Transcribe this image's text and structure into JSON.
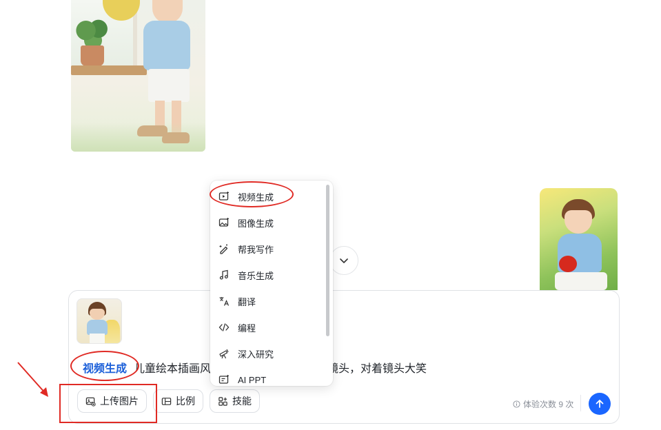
{
  "chat": {
    "top_image_alt": "",
    "right_image_alt": ""
  },
  "composer": {
    "mode_tag": "视频生成",
    "prompt_text": "儿童绘本插画风",
    "prompt_tail": "，展示给镜头，对着镜头大笑",
    "upload_label": "上传图片",
    "ratio_label": "比例",
    "skills_label": "技能",
    "quota_text": "体验次数 9 次"
  },
  "skills_menu": {
    "items": [
      {
        "label": "视频生成",
        "icon": "video-generate-icon"
      },
      {
        "label": "图像生成",
        "icon": "image-generate-icon"
      },
      {
        "label": "帮我写作",
        "icon": "pen-write-icon"
      },
      {
        "label": "音乐生成",
        "icon": "music-note-icon"
      },
      {
        "label": "翻译",
        "icon": "translate-icon"
      },
      {
        "label": "编程",
        "icon": "code-icon"
      },
      {
        "label": "深入研究",
        "icon": "telescope-icon"
      },
      {
        "label": "AI PPT",
        "icon": "ppt-icon"
      }
    ]
  },
  "colors": {
    "accent": "#1a66ff",
    "mode_tag": "#1b5fd9",
    "annotation": "#e02a24"
  }
}
